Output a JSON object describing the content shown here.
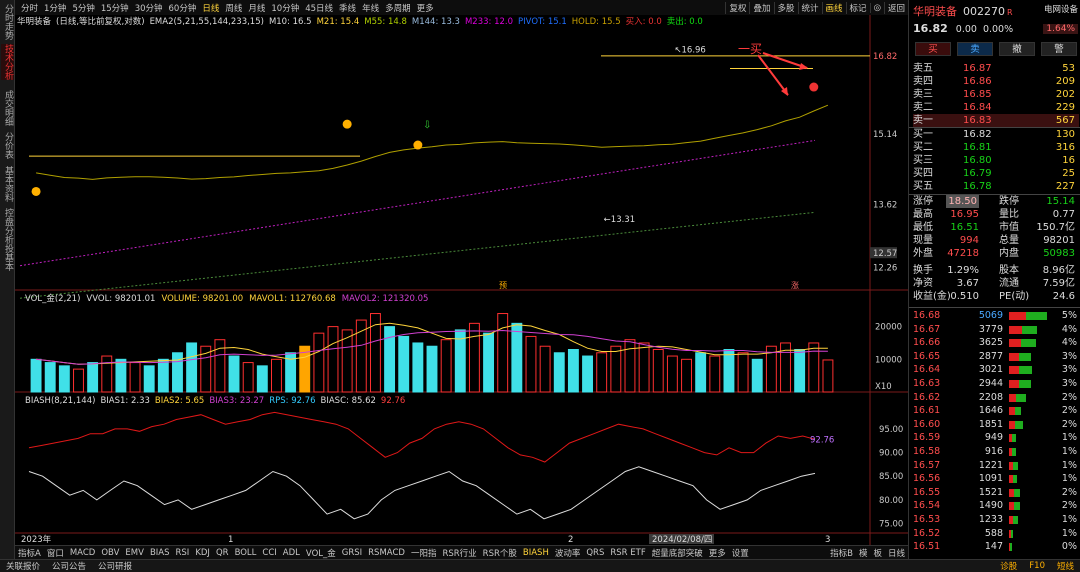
{
  "sidebar": {
    "tabs": [
      "分时走势",
      "技术分析",
      "成交明细",
      "分价表",
      "基本资料",
      "控盘分析",
      "投基本"
    ]
  },
  "toolbar": {
    "periods": [
      "分时",
      "1分钟",
      "5分钟",
      "15分钟",
      "30分钟",
      "60分钟",
      "日线",
      "周线",
      "月线",
      "10分钟",
      "45日线",
      "季线",
      "年线",
      "多周期",
      "更多"
    ],
    "active": "日线",
    "right": [
      "复权",
      "叠加",
      "多股",
      "统计",
      "画线",
      "标记",
      "◎",
      "返回"
    ]
  },
  "main": {
    "title_line": {
      "stock": "华明装备",
      "mode": "(日线,等比前复权,对数)",
      "ema": "EMA2(5,21,55,144,233,15)",
      "m10": "M10: 16.5",
      "m21": "M21: 15.4",
      "m55": "M55: 14.8",
      "m144": "M144: 13.3",
      "m233": "M233: 12.0",
      "pivot": "PIVOT: 15.1",
      "hold": "HOLD: 15.5",
      "buy": "买入: 0.0",
      "sell": "卖出: 0.0"
    },
    "price_axis": [
      "16.82",
      "15.14",
      "13.62",
      "12.57",
      "12.26"
    ],
    "annotations": {
      "high": "16.96",
      "low": "13.31",
      "buy_note": "一买"
    },
    "vol_line": {
      "name": "VOL_金(2,21)",
      "vvol": "VVOL: 98201.01",
      "volume": "VOLUME: 98201.00",
      "mavol1": "MAVOL1: 112760.68",
      "mavol2": "MAVOL2: 121320.05"
    },
    "vol_axis": [
      "20000",
      "10000",
      "X10"
    ],
    "bias_line": {
      "name": "BIASH(8,21,144)",
      "b1": "BIAS1: 2.33",
      "b2": "BIAS2: 5.65",
      "b3": "BIAS3: 23.27",
      "rps": "RPS: 92.76",
      "biasc": "BIASC: 85.62",
      "last": "92.76"
    },
    "bias_axis": [
      "95.00",
      "90.00",
      "85.00",
      "80.00",
      "75.00"
    ],
    "date_axis": [
      "2023年",
      "1",
      "2",
      "2024/02/08/四",
      "3"
    ],
    "marks": [
      "预",
      "涨"
    ]
  },
  "bottom_tabs": [
    "指标A",
    "窗口",
    "MACD",
    "OBV",
    "EMV",
    "BIAS",
    "RSI",
    "KDJ",
    "QR",
    "BOLL",
    "CCI",
    "ADL",
    "VOL_金",
    "GRSI",
    "RSMACD",
    "一阳指",
    "RSR行业",
    "RSR个股",
    "BIASH",
    "波动率",
    "QRS",
    "RSR ETF",
    "超量底部突破",
    "更多",
    "设置",
    "指标B",
    "模",
    "板",
    "日线"
  ],
  "status": {
    "items": [
      "关联报价",
      "公司公告",
      "公司研报",
      "公司研报"
    ],
    "right": [
      "诊股",
      "F10",
      "短线"
    ]
  },
  "quote": {
    "name": "华明装备",
    "code": "002270",
    "tag": "R",
    "badge": "电网设备",
    "price": "16.82",
    "change": "0.00",
    "pct": "0.00%",
    "pct2": "1.64%",
    "buttons": [
      "买",
      "卖",
      "撤",
      "警"
    ],
    "asks": [
      {
        "label": "卖五",
        "price": "16.87",
        "vol": "53"
      },
      {
        "label": "卖四",
        "price": "16.86",
        "vol": "209"
      },
      {
        "label": "卖三",
        "price": "16.85",
        "vol": "202"
      },
      {
        "label": "卖二",
        "price": "16.84",
        "vol": "229"
      },
      {
        "label": "卖一",
        "price": "16.83",
        "vol": "567"
      }
    ],
    "bids": [
      {
        "label": "买一",
        "price": "16.82",
        "vol": "130"
      },
      {
        "label": "买二",
        "price": "16.81",
        "vol": "316"
      },
      {
        "label": "买三",
        "price": "16.80",
        "vol": "16"
      },
      {
        "label": "买四",
        "price": "16.79",
        "vol": "25"
      },
      {
        "label": "买五",
        "price": "16.78",
        "vol": "227"
      }
    ],
    "stats": [
      [
        "涨停",
        "18.50",
        "跌停",
        "15.14"
      ],
      [
        "最高",
        "16.95",
        "量比",
        "0.77"
      ],
      [
        "最低",
        "16.51",
        "市值",
        "150.7亿"
      ],
      [
        "现量",
        "994",
        "总量",
        "98201"
      ],
      [
        "外盘",
        "47218",
        "内盘",
        "50983"
      ],
      [
        "换手",
        "1.29%",
        "股本",
        "8.96亿"
      ],
      [
        "净资",
        "3.67",
        "流通",
        "7.59亿"
      ],
      [
        "收益(金)",
        "0.510",
        "PE(动)",
        "24.6"
      ]
    ],
    "ladder": [
      [
        "16.68",
        "5069",
        "5%"
      ],
      [
        "16.67",
        "3779",
        "4%"
      ],
      [
        "16.66",
        "3625",
        "4%"
      ],
      [
        "16.65",
        "2877",
        "3%"
      ],
      [
        "16.64",
        "3021",
        "3%"
      ],
      [
        "16.63",
        "2944",
        "3%"
      ],
      [
        "16.62",
        "2208",
        "2%"
      ],
      [
        "16.61",
        "1646",
        "2%"
      ],
      [
        "16.60",
        "1851",
        "2%"
      ],
      [
        "16.59",
        "949",
        "1%"
      ],
      [
        "16.58",
        "916",
        "1%"
      ],
      [
        "16.57",
        "1221",
        "1%"
      ],
      [
        "16.56",
        "1091",
        "1%"
      ],
      [
        "16.55",
        "1521",
        "2%"
      ],
      [
        "16.54",
        "1490",
        "2%"
      ],
      [
        "16.53",
        "1233",
        "1%"
      ],
      [
        "16.52",
        "588",
        "1%"
      ],
      [
        "16.51",
        "147",
        "0%"
      ]
    ]
  },
  "chart_data": {
    "type": "candlestick",
    "candles": [
      [
        14.4,
        14.5,
        14.2,
        14.3
      ],
      [
        14.3,
        14.4,
        14.1,
        14.2
      ],
      [
        14.2,
        14.3,
        14.0,
        14.1
      ],
      [
        14.1,
        14.2,
        13.9,
        14.15
      ],
      [
        14.15,
        14.3,
        14.0,
        14.05
      ],
      [
        14.05,
        14.4,
        14.0,
        14.35
      ],
      [
        14.35,
        14.45,
        14.2,
        14.3
      ],
      [
        14.3,
        14.4,
        14.2,
        14.3
      ],
      [
        14.3,
        14.35,
        14.1,
        14.2
      ],
      [
        14.2,
        14.3,
        14.0,
        14.1
      ],
      [
        14.1,
        14.2,
        13.95,
        14.05
      ],
      [
        14.05,
        14.1,
        13.8,
        13.9
      ],
      [
        13.9,
        14.4,
        13.85,
        14.3
      ],
      [
        14.3,
        14.6,
        14.2,
        14.5
      ],
      [
        14.5,
        14.7,
        14.3,
        14.4
      ],
      [
        14.4,
        14.8,
        14.3,
        14.7
      ],
      [
        14.7,
        14.9,
        14.5,
        14.6
      ],
      [
        14.6,
        14.8,
        14.5,
        14.7
      ],
      [
        14.7,
        14.8,
        14.4,
        14.5
      ],
      [
        14.5,
        14.8,
        14.4,
        14.75
      ],
      [
        14.75,
        14.9,
        14.6,
        14.8
      ],
      [
        14.8,
        15.5,
        14.7,
        15.4
      ],
      [
        15.4,
        15.9,
        15.2,
        15.7
      ],
      [
        15.7,
        16.1,
        15.5,
        15.9
      ],
      [
        15.9,
        16.3,
        15.7,
        16.2
      ],
      [
        16.2,
        16.4,
        15.8,
        15.9
      ],
      [
        15.9,
        16.0,
        15.3,
        15.5
      ],
      [
        15.5,
        15.6,
        15.0,
        15.1
      ],
      [
        15.1,
        15.3,
        14.7,
        14.9
      ],
      [
        14.9,
        15.2,
        14.7,
        15.0
      ],
      [
        15.0,
        15.2,
        14.3,
        14.4
      ],
      [
        14.4,
        14.8,
        14.2,
        14.7
      ],
      [
        14.7,
        14.9,
        14.2,
        14.3
      ],
      [
        14.3,
        14.6,
        14.0,
        14.5
      ],
      [
        14.5,
        14.7,
        13.9,
        14.0
      ],
      [
        14.0,
        14.3,
        13.7,
        14.2
      ],
      [
        14.2,
        14.6,
        14.0,
        14.5
      ],
      [
        14.5,
        14.7,
        14.2,
        14.4
      ],
      [
        14.4,
        14.6,
        14.1,
        14.3
      ],
      [
        14.3,
        14.5,
        13.9,
        14.0
      ],
      [
        14.0,
        14.3,
        13.31,
        14.2
      ],
      [
        14.2,
        15.2,
        13.9,
        15.1
      ],
      [
        15.1,
        15.7,
        15.0,
        15.6
      ],
      [
        15.6,
        16.1,
        15.4,
        15.9
      ],
      [
        15.9,
        16.4,
        15.7,
        16.3
      ],
      [
        16.3,
        16.96,
        16.1,
        16.5
      ],
      [
        16.5,
        16.7,
        16.2,
        16.6
      ],
      [
        16.6,
        16.7,
        16.1,
        16.2
      ],
      [
        16.2,
        16.5,
        16.0,
        16.4
      ],
      [
        16.4,
        16.5,
        16.0,
        16.1
      ],
      [
        16.1,
        16.3,
        15.9,
        16.2
      ],
      [
        16.2,
        16.4,
        15.8,
        15.9
      ],
      [
        15.9,
        16.5,
        15.8,
        16.4
      ],
      [
        16.4,
        16.6,
        16.2,
        16.5
      ],
      [
        16.5,
        16.6,
        16.1,
        16.2
      ],
      [
        16.2,
        16.9,
        16.2,
        16.8
      ],
      [
        16.8,
        16.95,
        16.51,
        16.82
      ]
    ],
    "volume": [
      10,
      9,
      8,
      7,
      9,
      11,
      10,
      9,
      8,
      10,
      12,
      15,
      14,
      16,
      11,
      9,
      8,
      10,
      12,
      14,
      18,
      20,
      19,
      22,
      24,
      20,
      17,
      15,
      14,
      16,
      19,
      21,
      18,
      24,
      21,
      17,
      14,
      12,
      13,
      11,
      12,
      14,
      16,
      15,
      13,
      11,
      10,
      12,
      11,
      13,
      12,
      10,
      14,
      15,
      13,
      15,
      9.8
    ],
    "bias_red": [
      91,
      91.5,
      92,
      92.5,
      93,
      94,
      94,
      95,
      95,
      94.5,
      95.5,
      96,
      97,
      97.5,
      98,
      97,
      96,
      96.5,
      97,
      98,
      98.5,
      98,
      97.5,
      97,
      96.5,
      96,
      95,
      93,
      91,
      89,
      90,
      92,
      93,
      95,
      96,
      96.5,
      96,
      95,
      93,
      91,
      89.5,
      89,
      88,
      90,
      92,
      93,
      94,
      95,
      96,
      95.5,
      95,
      94,
      93,
      92,
      91,
      90,
      89.5,
      91,
      90,
      90,
      92,
      93.5,
      93,
      93.5,
      92.8
    ],
    "bias_white": [
      86,
      85,
      83,
      81,
      82,
      80,
      82,
      84,
      83,
      81,
      79,
      80,
      78,
      79,
      80,
      81,
      82,
      84,
      86,
      85,
      83,
      80,
      77,
      78,
      76,
      77,
      80,
      82,
      83,
      84,
      85,
      86,
      84,
      83,
      81,
      79,
      77,
      78,
      76,
      77,
      78,
      80,
      82,
      84,
      86,
      87,
      86,
      85,
      84,
      83,
      80,
      78,
      79,
      80,
      82,
      83,
      84,
      85,
      85.6
    ]
  }
}
